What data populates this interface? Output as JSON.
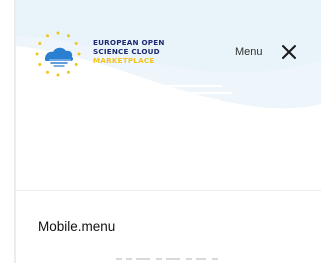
{
  "brand": {
    "line1": "EUROPEAN OPEN",
    "line2": "SCIENCE CLOUD",
    "line3": "MARKETPLACE"
  },
  "header": {
    "menu_label": "Menu",
    "close_icon": "close-icon"
  },
  "content": {
    "item_label": "Mobile.menu"
  },
  "colors": {
    "brand_navy": "#1f2a72",
    "brand_yellow": "#f2c41f",
    "header_tint": "#eef6fb"
  }
}
